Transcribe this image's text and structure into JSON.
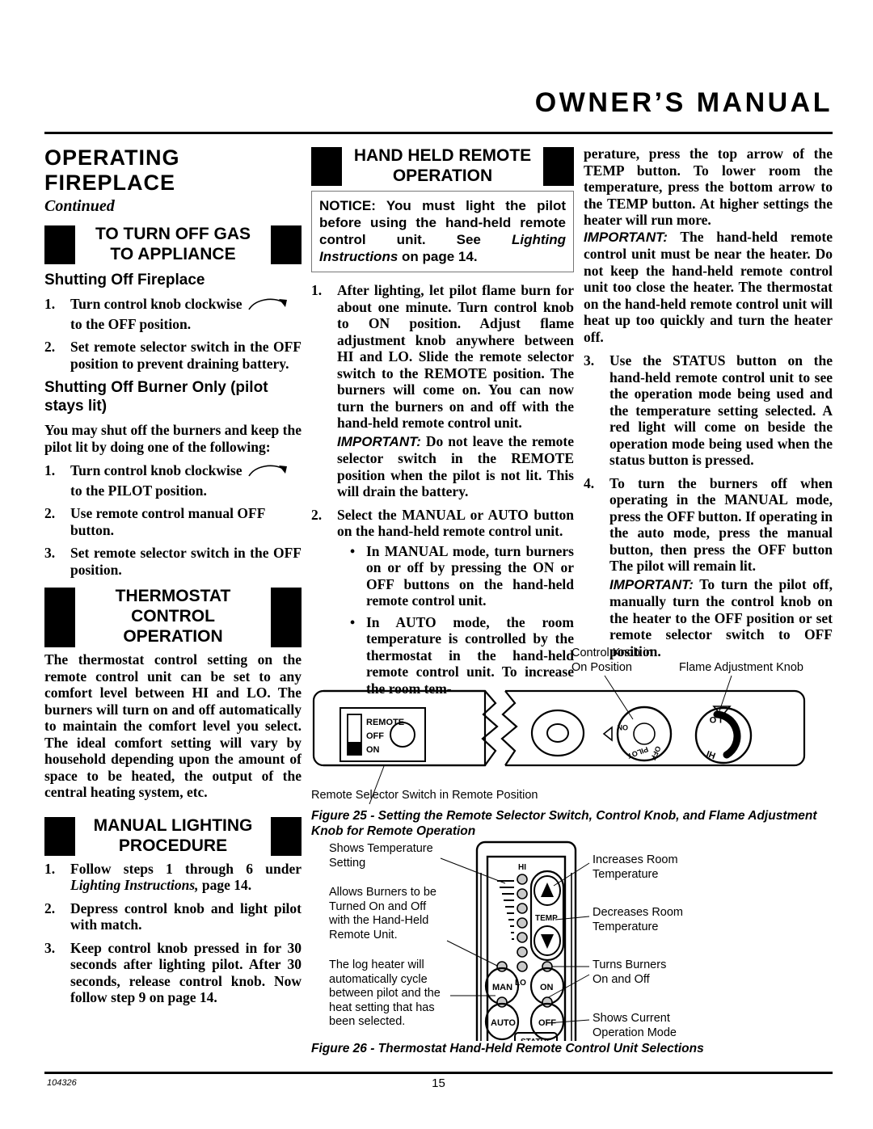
{
  "header": {
    "title": "OWNER’S MANUAL"
  },
  "footer": {
    "code": "104326",
    "page_number": "15"
  },
  "left_column": {
    "heading_line1": "OPERATING",
    "heading_line2": "FIREPLACE",
    "continued": "Continued",
    "section1": {
      "title_line1": "TO TURN OFF GAS",
      "title_line2": "TO APPLIANCE",
      "sub1": "Shutting Off Fireplace",
      "sub1_steps": [
        {
          "num": "1.",
          "text": "Turn control knob clockwise",
          "arrow": true,
          "text2": "to the OFF position."
        },
        {
          "num": "2.",
          "text": "Set remote selector switch in the OFF position to prevent draining battery.",
          "arrow": false
        }
      ],
      "sub2": "Shutting Off Burner Only (pilot stays lit)",
      "sub2_intro": "You may shut off the burners and keep the pilot lit by doing one of the following:",
      "sub2_steps": [
        {
          "num": "1.",
          "text": "Turn control knob clockwise",
          "arrow": true,
          "text2": "to the PILOT position."
        },
        {
          "num": "2.",
          "text": "Use remote control manual OFF button.",
          "arrow": false
        },
        {
          "num": "3.",
          "text": "Set remote selector switch in the OFF position.",
          "arrow": false
        }
      ]
    },
    "section2": {
      "title_line1": "THERMOSTAT",
      "title_line2": "CONTROL",
      "title_line3": "OPERATION",
      "paragraph": "The thermostat control setting on the remote control unit can be set to any comfort level between HI and LO. The burners will turn on and off automatically to maintain the comfort level you select. The ideal comfort setting will vary by household depending upon the amount of space to be heated, the output of the central heating system, etc."
    },
    "section3": {
      "title_line1": "MANUAL LIGHTING",
      "title_line2": "PROCEDURE",
      "steps": [
        {
          "num": "1.",
          "pre": "Follow steps 1 through 6 under ",
          "italic": "Lighting Instructions,",
          "post": " page 14."
        },
        {
          "num": "2.",
          "pre": "Depress control knob and light pilot with match.",
          "italic": "",
          "post": ""
        },
        {
          "num": "3.",
          "pre": "Keep control knob pressed in for 30 seconds after lighting pilot. After 30 seconds, release control knob. Now follow step 9 on page 14.",
          "italic": "",
          "post": ""
        }
      ]
    }
  },
  "middle_column": {
    "section_title_line1": "HAND HELD REMOTE",
    "section_title_line2": "OPERATION",
    "notice": {
      "lead": "NOTICE: You must light the pilot before using the hand-held remote control unit. See ",
      "italic": "Lighting Instructions",
      "tail": " on page 14."
    },
    "steps": [
      {
        "num": "1.",
        "text": "After lighting, let pilot flame burn for about one minute. Turn control knob to ON position. Adjust flame adjustment knob anywhere between HI and LO. Slide the remote selector switch to the REMOTE position. The burners will come on. You can now turn the burners on and off with the hand-held remote control unit.",
        "important_label": "IMPORTANT:",
        "important_text": " Do not leave the remote selector switch in the REMOTE position when the pilot is not lit. This will drain the battery."
      },
      {
        "num": "2.",
        "text": "Select the MANUAL or AUTO button on the hand-held remote control unit.",
        "bullets": [
          "In MANUAL mode, turn burners on or off by pressing the ON or OFF buttons on the hand-held remote control unit.",
          "In AUTO mode, the room temperature is controlled by the thermostat in the hand-held remote control unit. To increase the room tem-"
        ]
      }
    ]
  },
  "right_column": {
    "continuation": "perature, press the top arrow of the TEMP button. To lower room the temperature, press the bottom arrow to the TEMP button. At higher settings the heater will run more.",
    "important1_label": "IMPORTANT:",
    "important1_text": " The hand-held remote control unit must be near the heater. Do not keep the hand-held remote control unit too close the heater. The thermostat on the hand-held remote control unit will heat up too quickly and turn the heater off.",
    "steps": [
      {
        "num": "3.",
        "text": "Use the STATUS button on the hand-held remote control unit to see the operation mode being used and the temperature setting selected. A red light will come on beside the operation mode being used when the status button is pressed."
      },
      {
        "num": "4.",
        "text": "To turn the burners off when operating in the MANUAL mode, press the OFF button. If operating in the auto mode, press the manual button, then press the OFF button The pilot will remain lit.",
        "important_label": "IMPORTANT:",
        "important_text": " To turn the pilot off, manually turn the control knob on the heater to the OFF position or set remote selector switch to OFF position."
      }
    ]
  },
  "figure25": {
    "callout_control_knob_line1": "Control Knob in",
    "callout_control_knob_line2": "On Position",
    "callout_flame_knob": "Flame Adjustment Knob",
    "callout_remote_switch": "Remote Selector Switch in Remote Position",
    "switch_labels": [
      "REMOTE",
      "OFF",
      "ON"
    ],
    "control_knob_labels": [
      "ON",
      "PILOT",
      "OFF"
    ],
    "flame_knob_labels": [
      "LO",
      "HI"
    ],
    "caption": "Figure 25 - Setting the Remote Selector Switch, Control Knob, and Flame Adjustment Knob for Remote Operation"
  },
  "figure26": {
    "left_callouts": [
      "Shows Temperature\nSetting",
      "Allows Burners to be\nTurned On and Off\nwith the Hand-Held\nRemote Unit.",
      "The log heater will\nautomatically cycle\nbetween pilot and the\nheat setting that has\nbeen selected."
    ],
    "right_callouts": [
      "Increases Room\nTemperature",
      "Decreases Room\nTemperature",
      "Turns Burners\nOn and Off",
      "Shows Current\nOperation Mode"
    ],
    "remote_labels": {
      "hi": "HI",
      "lo": "LO",
      "temp": "TEMP",
      "man": "MAN",
      "auto": "AUTO",
      "on": "ON",
      "off": "OFF",
      "status": "STATUS"
    },
    "caption": "Figure 26  - Thermostat Hand-Held Remote Control Unit Selections"
  }
}
